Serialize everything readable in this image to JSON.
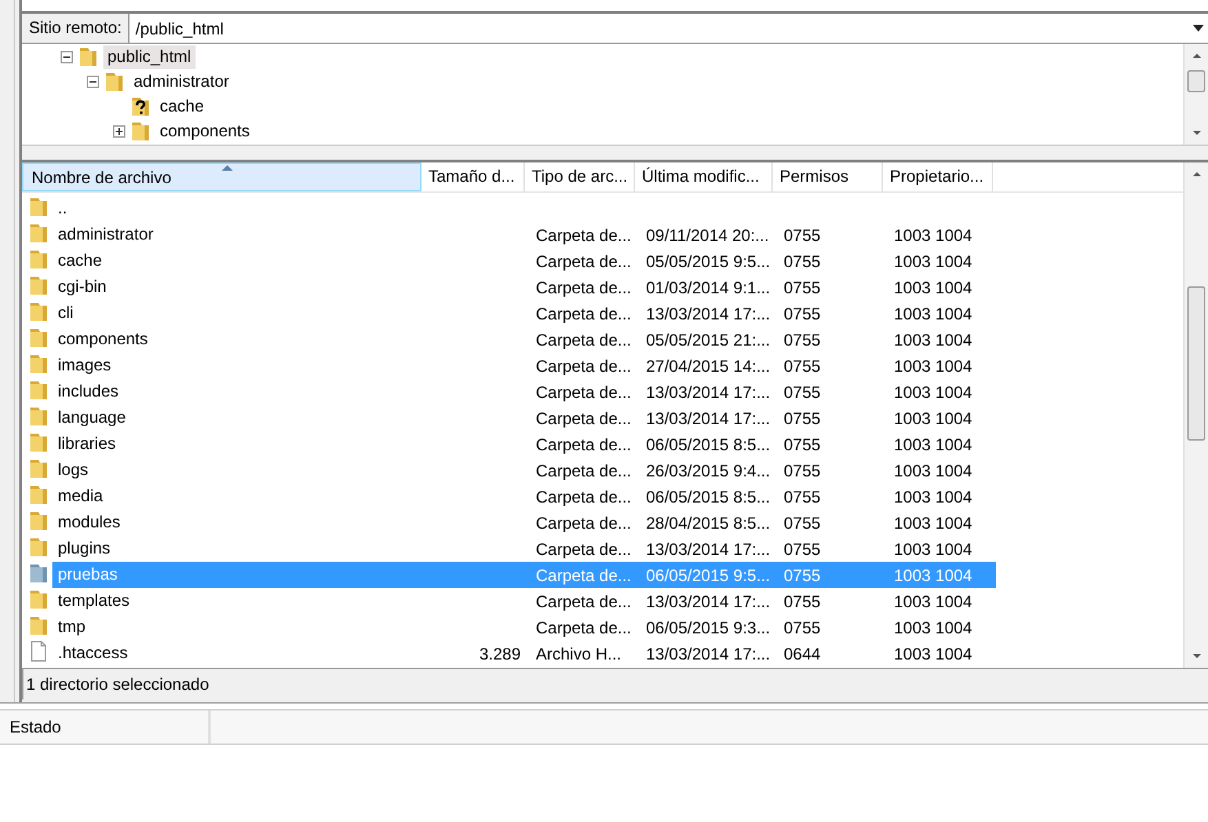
{
  "remote_site": {
    "label": "Sitio remoto:",
    "value": "/public_html"
  },
  "tree": [
    {
      "label": "public_html",
      "kind": "folder",
      "selected": true,
      "expanded": true,
      "children": [
        {
          "label": "administrator",
          "kind": "folder",
          "selected": false,
          "expanded": true,
          "children": [
            {
              "label": "cache",
              "kind": "unknown",
              "selected": false
            },
            {
              "label": "components",
              "kind": "folder",
              "selected": false,
              "expanded": false
            }
          ]
        }
      ]
    }
  ],
  "table": {
    "columns": [
      {
        "label": "Nombre de archivo",
        "sorted": true
      },
      {
        "label": "Tamaño d...",
        "sorted": false
      },
      {
        "label": "Tipo de arc...",
        "sorted": false
      },
      {
        "label": "Última modific...",
        "sorted": false
      },
      {
        "label": "Permisos",
        "sorted": false
      },
      {
        "label": "Propietario...",
        "sorted": false
      }
    ],
    "rows": [
      {
        "kind": "folder",
        "selected": false,
        "cells": [
          "..",
          "",
          "",
          "",
          "",
          ""
        ]
      },
      {
        "kind": "folder",
        "selected": false,
        "cells": [
          "administrator",
          "",
          "Carpeta de...",
          "09/11/2014 20:...",
          "0755",
          "1003 1004"
        ]
      },
      {
        "kind": "folder",
        "selected": false,
        "cells": [
          "cache",
          "",
          "Carpeta de...",
          "05/05/2015 9:5...",
          "0755",
          "1003 1004"
        ]
      },
      {
        "kind": "folder",
        "selected": false,
        "cells": [
          "cgi-bin",
          "",
          "Carpeta de...",
          "01/03/2014 9:1...",
          "0755",
          "1003 1004"
        ]
      },
      {
        "kind": "folder",
        "selected": false,
        "cells": [
          "cli",
          "",
          "Carpeta de...",
          "13/03/2014 17:...",
          "0755",
          "1003 1004"
        ]
      },
      {
        "kind": "folder",
        "selected": false,
        "cells": [
          "components",
          "",
          "Carpeta de...",
          "05/05/2015 21:...",
          "0755",
          "1003 1004"
        ]
      },
      {
        "kind": "folder",
        "selected": false,
        "cells": [
          "images",
          "",
          "Carpeta de...",
          "27/04/2015 14:...",
          "0755",
          "1003 1004"
        ]
      },
      {
        "kind": "folder",
        "selected": false,
        "cells": [
          "includes",
          "",
          "Carpeta de...",
          "13/03/2014 17:...",
          "0755",
          "1003 1004"
        ]
      },
      {
        "kind": "folder",
        "selected": false,
        "cells": [
          "language",
          "",
          "Carpeta de...",
          "13/03/2014 17:...",
          "0755",
          "1003 1004"
        ]
      },
      {
        "kind": "folder",
        "selected": false,
        "cells": [
          "libraries",
          "",
          "Carpeta de...",
          "06/05/2015 8:5...",
          "0755",
          "1003 1004"
        ]
      },
      {
        "kind": "folder",
        "selected": false,
        "cells": [
          "logs",
          "",
          "Carpeta de...",
          "26/03/2015 9:4...",
          "0755",
          "1003 1004"
        ]
      },
      {
        "kind": "folder",
        "selected": false,
        "cells": [
          "media",
          "",
          "Carpeta de...",
          "06/05/2015 8:5...",
          "0755",
          "1003 1004"
        ]
      },
      {
        "kind": "folder",
        "selected": false,
        "cells": [
          "modules",
          "",
          "Carpeta de...",
          "28/04/2015 8:5...",
          "0755",
          "1003 1004"
        ]
      },
      {
        "kind": "folder",
        "selected": false,
        "cells": [
          "plugins",
          "",
          "Carpeta de...",
          "13/03/2014 17:...",
          "0755",
          "1003 1004"
        ]
      },
      {
        "kind": "folder",
        "selected": true,
        "cells": [
          "pruebas",
          "",
          "Carpeta de...",
          "06/05/2015 9:5...",
          "0755",
          "1003 1004"
        ]
      },
      {
        "kind": "folder",
        "selected": false,
        "cells": [
          "templates",
          "",
          "Carpeta de...",
          "13/03/2014 17:...",
          "0755",
          "1003 1004"
        ]
      },
      {
        "kind": "folder",
        "selected": false,
        "cells": [
          "tmp",
          "",
          "Carpeta de...",
          "06/05/2015 9:3...",
          "0755",
          "1003 1004"
        ]
      },
      {
        "kind": "file",
        "selected": false,
        "cells": [
          ".htaccess",
          "3.289",
          "Archivo H...",
          "13/03/2014 17:...",
          "0644",
          "1003 1004"
        ]
      }
    ]
  },
  "status_bar": "1 directorio seleccionado",
  "log_tabs": [
    {
      "label": "Estado"
    }
  ]
}
